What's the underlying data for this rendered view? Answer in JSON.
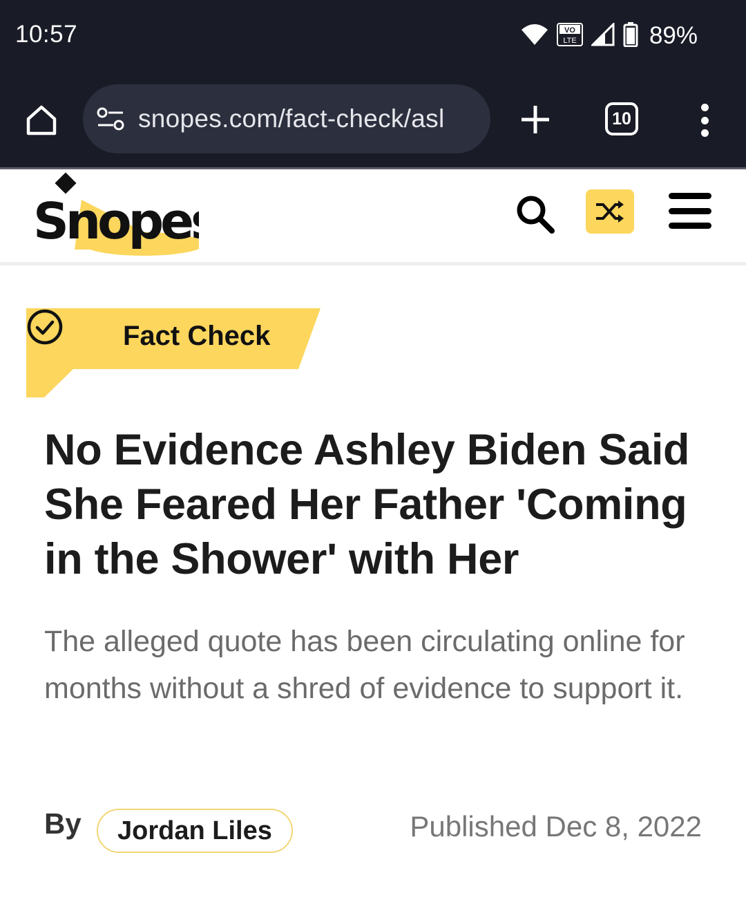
{
  "status_bar": {
    "time": "10:57",
    "network_badge_top": "VO",
    "network_badge_bottom": "LTE",
    "battery": "89%",
    "icons": [
      "wifi-icon",
      "volte-icon",
      "signal-icon",
      "battery-icon"
    ]
  },
  "browser": {
    "url": "snopes.com/fact-check/asl",
    "tab_count": "10",
    "icons": [
      "home-icon",
      "site-settings-icon",
      "plus-icon",
      "tabs-icon",
      "overflow-menu-icon"
    ]
  },
  "site": {
    "logo_text": "Snopes",
    "brand_color": "#fcd65d",
    "icons": [
      "search-icon",
      "shuffle-icon",
      "hamburger-menu-icon"
    ]
  },
  "article": {
    "category": "Fact Check",
    "headline": "No Evidence Ashley Biden Said She Feared Her Father 'Coming in the Shower' with Her",
    "subhead": "The alleged quote has been circulating online for months without a shred of evidence to support it.",
    "by_label": "By",
    "author": "Jordan Liles",
    "published": "Published Dec 8, 2022"
  }
}
